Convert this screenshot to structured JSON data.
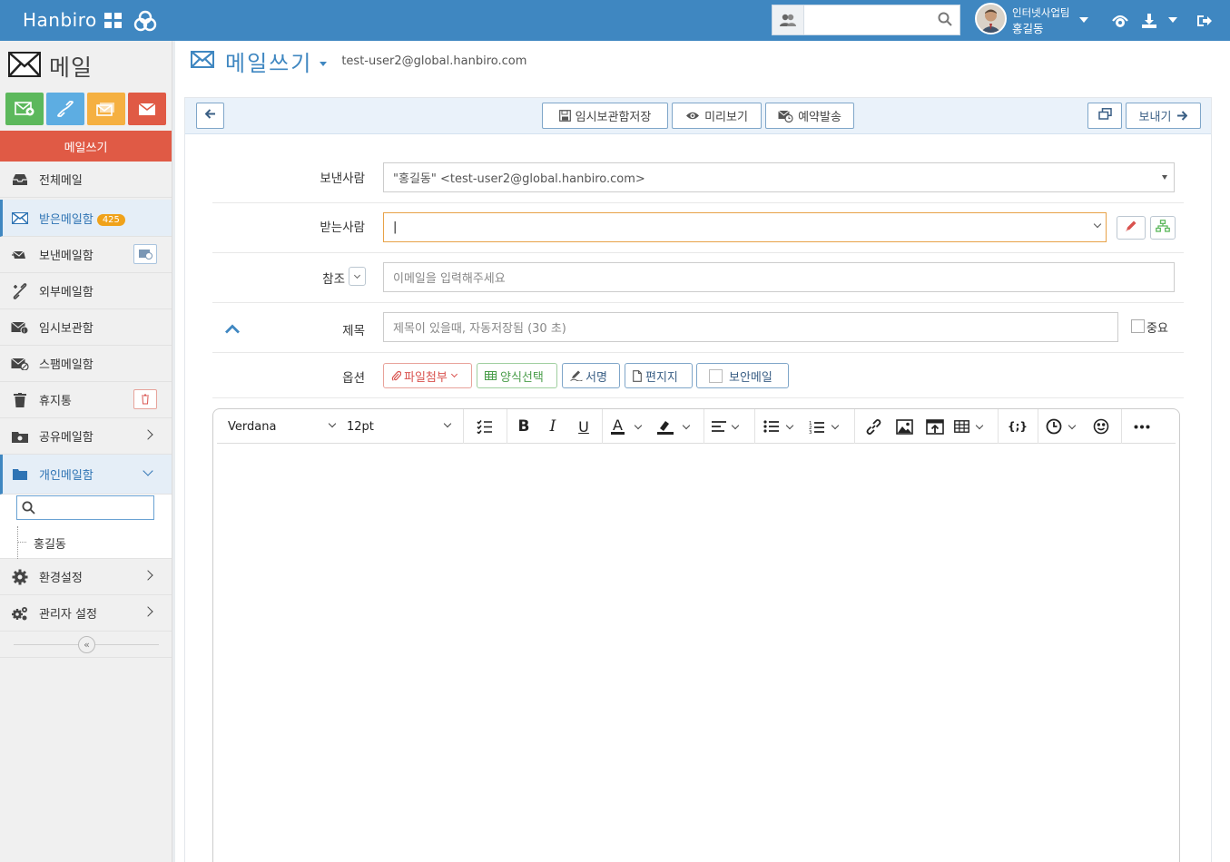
{
  "topbar": {
    "brand": "Hanbiro",
    "search_placeholder": "",
    "user_org": "인터넷사업팀",
    "user_name": "홍길동"
  },
  "sidebar": {
    "title": "메일",
    "compose_label": "메일쓰기",
    "items": [
      {
        "label": "전체메일"
      },
      {
        "label": "받은메일함",
        "badge": "425"
      },
      {
        "label": "보낸메일함"
      },
      {
        "label": "외부메일함"
      },
      {
        "label": "임시보관함"
      },
      {
        "label": "스팸메일함"
      },
      {
        "label": "휴지통"
      },
      {
        "label": "공유메일함"
      },
      {
        "label": "개인메일함"
      },
      {
        "label": "환경설정"
      },
      {
        "label": "관리자 설정"
      }
    ],
    "folder_search_placeholder": "",
    "folder_children": [
      {
        "label": "홍길동"
      }
    ],
    "collapse_glyph": "«"
  },
  "main": {
    "title": "메일쓰기",
    "account": "test-user2@global.hanbiro.com",
    "toolbar": {
      "save_draft": "임시보관함저장",
      "preview": "미리보기",
      "schedule": "예약발송",
      "send": "보내기"
    },
    "form": {
      "from_label": "보낸사람",
      "from_value": "\"홍길동\" <test-user2@global.hanbiro.com>",
      "to_label": "받는사람",
      "to_value": "|",
      "cc_label": "참조",
      "cc_placeholder": "이메일을 입력해주세요",
      "subject_label": "제목",
      "subject_placeholder": "제목이 있을때, 자동저장됨 (30 초)",
      "important_label": "중요",
      "options_label": "옵션",
      "options": {
        "attach": "파일첨부",
        "template": "양식선택",
        "signature": "서명",
        "stationery": "편지지",
        "secure": "보안메일"
      }
    },
    "editor": {
      "font_family": "Verdana",
      "font_size": "12pt"
    }
  }
}
